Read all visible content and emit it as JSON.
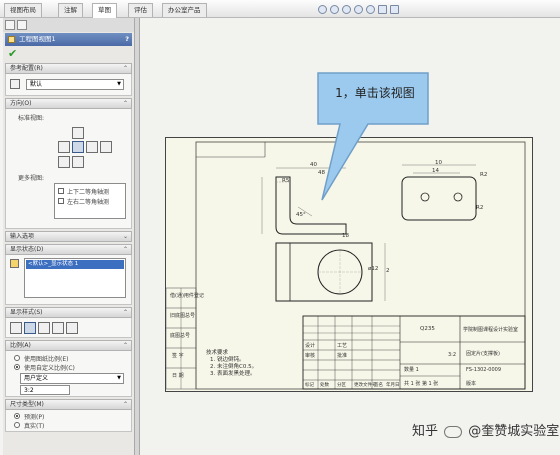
{
  "tabs": [
    {
      "label": "视图布局",
      "active": false
    },
    {
      "label": "注解",
      "active": false
    },
    {
      "label": "草图",
      "active": true
    },
    {
      "label": "评估",
      "active": false
    },
    {
      "label": "办公室产品",
      "active": false
    }
  ],
  "panel": {
    "title": "工程图视图1",
    "help": "?",
    "ok": "✔",
    "sections": {
      "ref_config": {
        "header": "参考配置(R)",
        "value": "默认"
      },
      "orientation": {
        "header": "方向(O)",
        "standard_views": "标准视图:",
        "more_views": "更多视图:",
        "more_items": [
          "上下二等角轴测",
          "左右二等角轴测"
        ]
      },
      "import": {
        "header": "输入选项"
      },
      "display_state": {
        "header": "显示状态(D)",
        "value": "<默认>_显示状态 1"
      },
      "display_style": {
        "header": "显示样式(S)"
      },
      "scale": {
        "header": "比例(A)",
        "opt1": "使用图纸比例(E)",
        "opt2": "使用自定义比例(C)",
        "custom_select": "用户定义",
        "value": "3:2"
      },
      "dim_type": {
        "header": "尺寸类型(M)",
        "opt1": "预测(P)",
        "opt2": "真实(T)"
      }
    }
  },
  "callout": {
    "text": "1，单击该视图"
  },
  "drawing": {
    "dims": [
      "40",
      "48",
      "R5",
      "10",
      "14",
      "R2",
      "45°",
      "18",
      "ø12",
      "2",
      "R2"
    ],
    "notes_title": "技术要求",
    "notes": [
      "1. 锐边倒钝。",
      "2. 未注倒角C0.5。",
      "3. 表面发黑处理。"
    ],
    "left_labels": [
      "借(通)用件登记",
      "旧底图总号",
      "底图总号",
      "签 字",
      "日 期"
    ],
    "title_block": {
      "material": "Q235",
      "company": "学院制图课程设计实验室",
      "part": "固定片(支撑板)",
      "scale": "3:2",
      "qty": "数量 1",
      "drawing_no": "FS-1302-0009",
      "sheet": "共 1 张 第 1 张",
      "version": "版本"
    },
    "tb_labels": [
      "设计",
      "审核",
      "工艺",
      "批准",
      "标记",
      "处数",
      "分区",
      "更改文件号",
      "签名",
      "年月日"
    ]
  },
  "watermark": {
    "text_left": "知乎",
    "text_right": "@奎赞城实验室"
  },
  "colors": {
    "title_bg": "#5778b2",
    "callout": "#8cc0ea",
    "sheet": "#f7f7e9"
  }
}
